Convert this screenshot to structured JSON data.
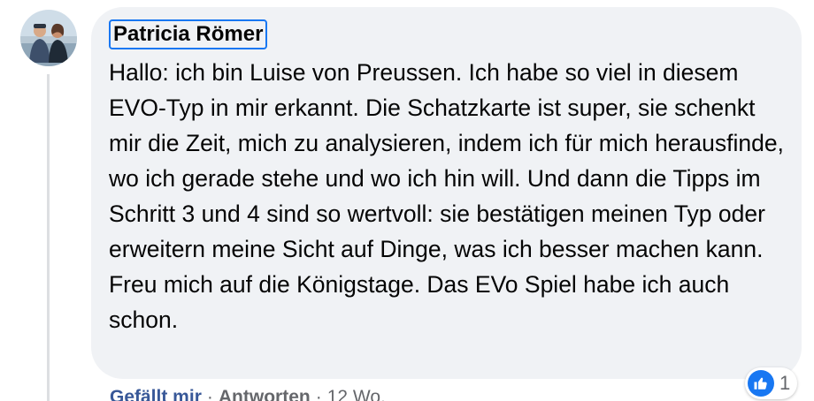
{
  "comment": {
    "author": "Patricia Römer",
    "text": "Hallo: ich bin Luise von Preussen. Ich habe so viel in diesem EVO-Typ in mir erkannt. Die Schatzkarte ist super, sie schenkt mir die Zeit, mich zu analysieren, indem ich für mich herausfinde, wo ich gerade stehe und wo ich hin will. Und dann die Tipps im Schritt 3 und 4 sind so wertvoll: sie bestätigen meinen Typ oder erweitern meine Sicht auf Dinge, was ich besser machen kann. Freu mich auf die Königstage. Das EVo Spiel habe ich auch schon.",
    "like_label": "Gefällt mir",
    "reply_label": "Antworten",
    "separator": "·",
    "timestamp": "12 Wo.",
    "reaction_icon": "like-thumbs-up-icon",
    "reaction_count": "1"
  },
  "colors": {
    "bubble": "#f0f2f5",
    "like_blue": "#1877f2",
    "link_blue": "#385898",
    "muted": "#65676b"
  }
}
